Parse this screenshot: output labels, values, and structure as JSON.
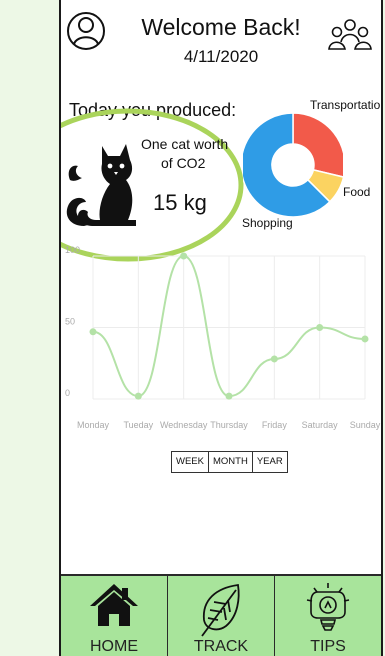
{
  "header": {
    "title": "Welcome Back!",
    "date": "4/11/2020"
  },
  "summary": {
    "intro": "Today you produced:",
    "equivalent_line1": "One cat worth",
    "equivalent_line2": "of CO2",
    "amount": "15 kg"
  },
  "donut": {
    "labels": {
      "transportation": "Transportation",
      "food": "Food",
      "shopping": "Shopping"
    },
    "colors": {
      "transportation": "#f25a4a",
      "food": "#fbd361",
      "shopping": "#2f9ce6"
    }
  },
  "chart_data": {
    "type": "line",
    "categories": [
      "Monday",
      "Tueday",
      "Wednesday",
      "Thursday",
      "Friday",
      "Saturday",
      "Sunday"
    ],
    "series": [
      {
        "values": [
          47,
          2,
          100,
          2,
          28,
          50,
          42
        ]
      }
    ],
    "yticks": [
      "0",
      "50",
      "100"
    ],
    "ylim": [
      0,
      100
    ],
    "grid": true,
    "color": "#b4e2a7"
  },
  "range_toggle": [
    "WEEK",
    "MONTH",
    "YEAR"
  ],
  "nav": {
    "home": "HOME",
    "track": "TRACK",
    "tips": "TIPS"
  },
  "accent": "#aad45b"
}
